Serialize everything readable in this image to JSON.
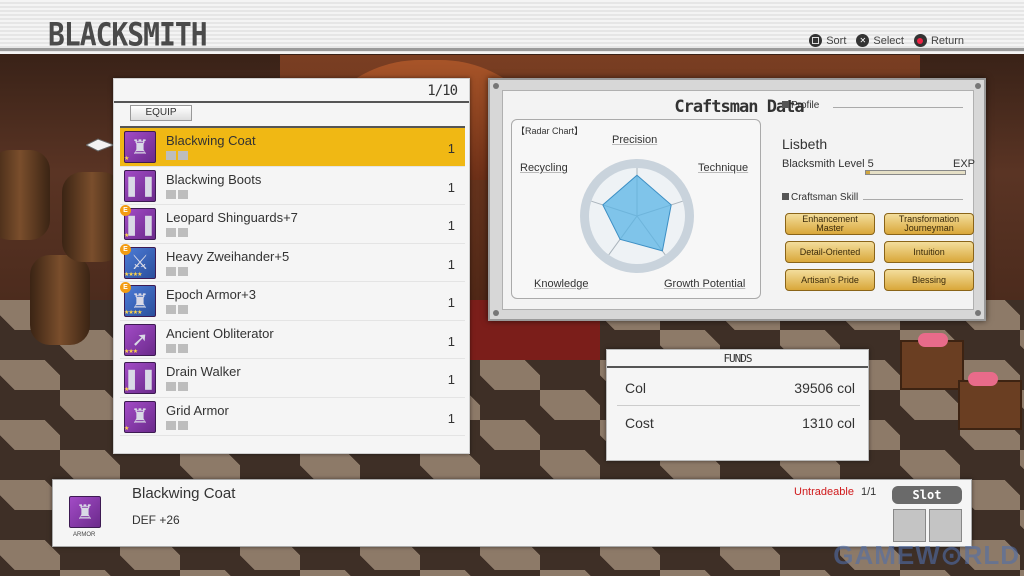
{
  "header": {
    "title": "BLACKSMITH",
    "hints": [
      {
        "glyph": "square",
        "label": "Sort"
      },
      {
        "glyph": "cross",
        "label": "Select"
      },
      {
        "glyph": "circle",
        "label": "Return"
      }
    ]
  },
  "item_list": {
    "count": "1/10",
    "tab_label": "EQUIP",
    "items": [
      {
        "name": "Blackwing Coat",
        "qty": "1",
        "icon": "coat-icon",
        "selected": true
      },
      {
        "name": "Blackwing Boots",
        "qty": "1",
        "icon": "boots-icon"
      },
      {
        "name": "Leopard Shinguards+7",
        "qty": "1",
        "icon": "boots-icon",
        "badge": "E"
      },
      {
        "name": "Heavy Zweihander+5",
        "qty": "1",
        "icon": "sword-icon",
        "badge": "E"
      },
      {
        "name": "Epoch Armor+3",
        "qty": "1",
        "icon": "armor-icon",
        "badge": "E"
      },
      {
        "name": "Ancient Obliterator",
        "qty": "1",
        "icon": "spear-icon"
      },
      {
        "name": "Drain Walker",
        "qty": "1",
        "icon": "boots-icon"
      },
      {
        "name": "Grid Armor",
        "qty": "1",
        "icon": "armor-icon"
      }
    ]
  },
  "craftsman": {
    "title": "Craftsman Data",
    "radar_caption": "【Radar Chart】",
    "radar_labels": {
      "precision": "Precision",
      "technique": "Technique",
      "growth": "Growth Potential",
      "knowledge": "Knowledge",
      "recycling": "Recycling"
    },
    "profile_header": "Profile",
    "name": "Lisbeth",
    "level_label": "Blacksmith Level",
    "level_value": "5",
    "exp_label": "EXP",
    "skill_header": "Craftsman Skill",
    "skills": [
      "Enhancement Master",
      "Transformation Journeyman",
      "Detail-Oriented",
      "Intuition",
      "Artisan's Pride",
      "Blessing"
    ]
  },
  "chart_data": {
    "type": "radar",
    "categories": [
      "Precision",
      "Technique",
      "Growth Potential",
      "Knowledge",
      "Recycling"
    ],
    "values": [
      0.85,
      0.75,
      0.9,
      0.6,
      0.75
    ],
    "max": 1.0
  },
  "funds": {
    "title": "FUNDS",
    "col_label": "Col",
    "col_value": "39506 col",
    "cost_label": "Cost",
    "cost_value": "1310 col"
  },
  "detail": {
    "name": "Blackwing Coat",
    "stat": "DEF +26",
    "category": "ARMOR",
    "tradeable": "Untradeable",
    "fraction": "1/1",
    "slot_label": "Slot"
  },
  "watermark": "GAMEW⊙RLD",
  "colors": {
    "selected_row": "#f0b814",
    "untradeable": "#d0191b",
    "skill_button": "#e3bc5a",
    "radar_fill": "#5ab4e6"
  }
}
